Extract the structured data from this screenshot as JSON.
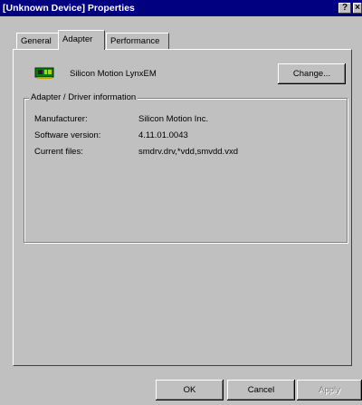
{
  "window": {
    "title": "[Unknown Device] Properties",
    "help_button": "?",
    "close_button": "×"
  },
  "tabs": [
    {
      "label": "General"
    },
    {
      "label": "Adapter"
    },
    {
      "label": "Performance"
    }
  ],
  "device": {
    "name": "Silicon Motion LynxEM",
    "change_button": "Change..."
  },
  "driver_info": {
    "group_label": "Adapter / Driver information",
    "rows": [
      {
        "label": "Manufacturer:",
        "value": "Silicon Motion Inc."
      },
      {
        "label": "Software version:",
        "value": "4.11.01.0043"
      },
      {
        "label": "Current files:",
        "value": "smdrv.drv,*vdd,smvdd.vxd"
      }
    ]
  },
  "footer": {
    "ok": "OK",
    "cancel": "Cancel",
    "apply": "Apply"
  },
  "colors": {
    "titlebar": "#000080",
    "face": "#c0c0c0",
    "icon_green": "#008000"
  }
}
